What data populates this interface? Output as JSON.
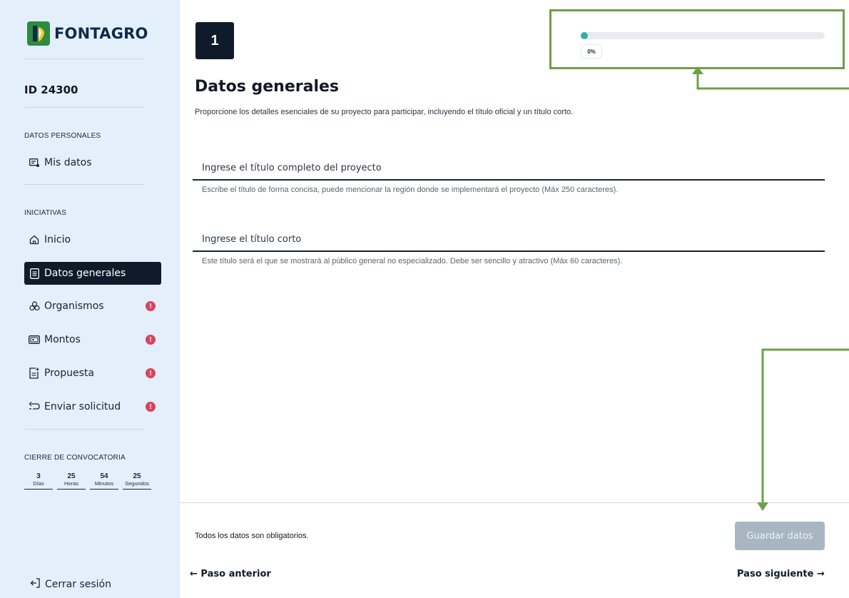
{
  "sidebar": {
    "brand": "FONTAGRO",
    "project_id": "ID 24300",
    "section_personal": "DATOS PERSONALES",
    "section_initiatives": "INICIATIVAS",
    "section_deadline": "CIERRE DE CONVOCATORIA",
    "items": [
      {
        "label": "Mis datos",
        "icon": "user-card-icon"
      },
      {
        "label": "Inicio",
        "icon": "home-icon"
      },
      {
        "label": "Datos generales",
        "icon": "document-icon",
        "active": true
      },
      {
        "label": "Organismos",
        "icon": "organisms-icon",
        "alert": "!"
      },
      {
        "label": "Montos",
        "icon": "money-icon",
        "alert": "!"
      },
      {
        "label": "Propuesta",
        "icon": "proposal-icon",
        "alert": "!"
      },
      {
        "label": "Enviar solicitud",
        "icon": "send-icon",
        "alert": "!"
      }
    ],
    "countdown": [
      {
        "value": "3",
        "unit": "Días"
      },
      {
        "value": "25",
        "unit": "Horas"
      },
      {
        "value": "54",
        "unit": "Minutos"
      },
      {
        "value": "25",
        "unit": "Segundos"
      }
    ],
    "logout": "Cerrar sesión"
  },
  "main": {
    "step_number": "1",
    "progress": {
      "value": 0,
      "label": "0%",
      "color": "#2db3a6"
    },
    "title": "Datos generales",
    "subtitle": "Proporcione los detalles esenciales de su proyecto para participar, incluyendo el título oficial y un título corto.",
    "fields": [
      {
        "placeholder": "Ingrese el título completo del proyecto",
        "hint": "Escribe el título de forma concisa, puede mencionar la región donde se implementará el proyecto (Máx 250 caracteres)."
      },
      {
        "placeholder": "Ingrese el título corto",
        "hint": "Este título será el que se mostrará al público general no especializado. Debe ser sencillo y atractivo (Máx 60 caracteres)."
      }
    ],
    "required_note": "Todos los datos son obligatorios.",
    "save_label": "Guardar datos",
    "prev_label": "← Paso anterior",
    "next_label": "Paso siguiente →"
  },
  "colors": {
    "annotation": "#6da046",
    "active_nav": "#0f1b2b",
    "alert": "#d9435f",
    "save_disabled": "#a7b6c2"
  }
}
